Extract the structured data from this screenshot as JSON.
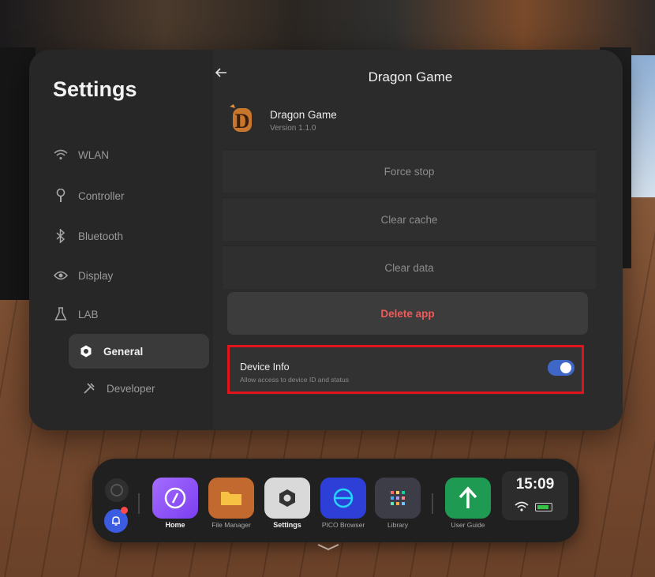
{
  "sidebar": {
    "title": "Settings",
    "items": [
      {
        "label": "WLAN",
        "icon": "wifi-icon"
      },
      {
        "label": "Controller",
        "icon": "controller-icon"
      },
      {
        "label": "Bluetooth",
        "icon": "bluetooth-icon"
      },
      {
        "label": "Display",
        "icon": "eye-icon"
      },
      {
        "label": "LAB",
        "icon": "flask-icon"
      },
      {
        "label": "General",
        "icon": "gear-icon",
        "active": true
      },
      {
        "label": "Developer",
        "icon": "tools-icon"
      }
    ]
  },
  "header": {
    "title": "Dragon Game",
    "back_icon": "back-arrow-icon"
  },
  "app": {
    "name": "Dragon Game",
    "version": "Version 1.1.0",
    "icon": "dragon-game-logo"
  },
  "actions": {
    "force_stop": "Force stop",
    "clear_cache": "Clear cache",
    "clear_data": "Clear data",
    "delete_app": "Delete app"
  },
  "device_info": {
    "label": "Device Info",
    "description": "Allow access to device ID and status",
    "enabled": true
  },
  "dock": {
    "apps": [
      {
        "label": "Home",
        "icon": "compass-icon",
        "color": "#8b5cf6"
      },
      {
        "label": "File Manager",
        "icon": "folder-icon",
        "color": "#c2692f"
      },
      {
        "label": "Settings",
        "icon": "settings-icon",
        "color": "#d9d9d9"
      },
      {
        "label": "PICO Browser",
        "icon": "browser-icon",
        "color": "#2d3fd6"
      },
      {
        "label": "Library",
        "icon": "grid-icon",
        "color": "#3d3d48"
      },
      {
        "label": "User Guide",
        "icon": "arrow-up-icon",
        "color": "#1f9a52"
      }
    ],
    "time": "15:09"
  },
  "colors": {
    "accent": "#3f67c8",
    "danger": "#ef5b5b",
    "highlight": "#e0141d"
  }
}
